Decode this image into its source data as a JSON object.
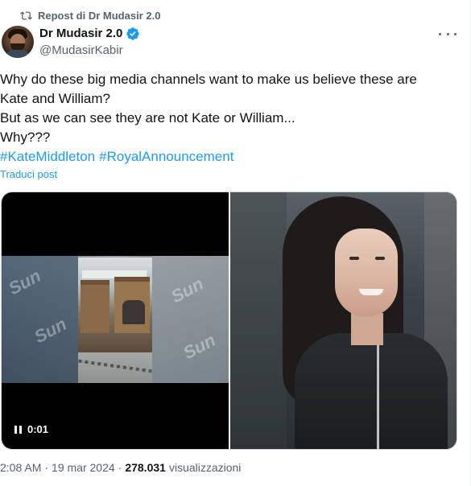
{
  "repost": {
    "label": "Repost di Dr Mudasir 2.0",
    "icon": "repost-icon"
  },
  "author": {
    "display_name": "Dr Mudasir 2.0",
    "handle": "@MudasirKabir",
    "verified": true,
    "avatar_icon": "avatar"
  },
  "post": {
    "lines": [
      "Why do these big media channels want to make us believe these are",
      "Kate and William?",
      "But as we can see they are not Kate or William...",
      "Why???"
    ],
    "hashtags": [
      "#KateMiddleton",
      "#RoyalAnnouncement"
    ],
    "translate_label": "Traduci post"
  },
  "media": {
    "video_time": "0:01",
    "watermark": "Sun"
  },
  "footer": {
    "time": "2:08 AM",
    "separator": "·",
    "date": "19 mar 2024",
    "views_count": "278.031",
    "views_label": "visualizzazioni"
  },
  "colors": {
    "accent": "#1d9bf0",
    "muted": "#536471",
    "text": "#0f1419"
  }
}
